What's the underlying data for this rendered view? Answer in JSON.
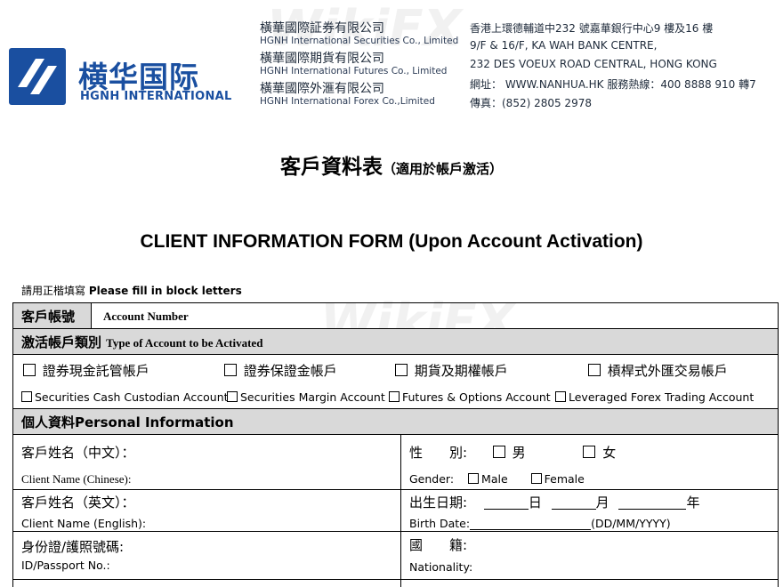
{
  "header": {
    "logo_cn": "横华国际",
    "logo_en": "HGNH INTERNATIONAL",
    "brand_color": "#1a4fa0",
    "companies": [
      {
        "cn": "橫華國際証券有限公司",
        "en": "HGNH International Securities Co., Limited"
      },
      {
        "cn": "橫華國際期貨有限公司",
        "en": "HGNH International Futures Co., Limited"
      },
      {
        "cn": "橫華國際外滙有限公司",
        "en": "HGNH International Forex Co.,Limited"
      }
    ],
    "address": [
      "香港上環德輔道中232 號嘉華銀行中心9 樓及16 樓",
      "9/F & 16/F, KA WAH BANK CENTRE,",
      "232 DES VOEUX ROAD CENTRAL, HONG KONG",
      "網址： WWW.NANHUA.HK 服務熱線：400 8888 910 轉7",
      "傳真：(852) 2805 2978"
    ]
  },
  "title": {
    "cn": "客戶資料表",
    "cn_note": "（適用於帳戶激活）",
    "en": "CLIENT INFORMATION FORM (Upon Account Activation)"
  },
  "note": {
    "cn": "請用正楷填寫",
    "en": "Please fill in block letters"
  },
  "form": {
    "account_number": {
      "cn": "客戶帳號",
      "en": "Account Number"
    },
    "account_type": {
      "cn": "激活帳戶類別",
      "en": "Type of Account to be Activated"
    },
    "account_options": [
      {
        "cn": "證券現金託管帳戶",
        "en": "Securities Cash Custodian Account"
      },
      {
        "cn": "證券保證金帳戶",
        "en": "Securities Margin Account"
      },
      {
        "cn": "期貨及期權帳戶",
        "en": "Futures & Options Account"
      },
      {
        "cn": "槓桿式外匯交易帳戶",
        "en": "Leveraged Forex Trading Account"
      }
    ],
    "personal_info": {
      "cn": "個人資料",
      "en": "Personal Information"
    },
    "name_cn": {
      "cn": "客戶姓名（中文）：",
      "en": "Client Name (Chinese):"
    },
    "gender": {
      "cn": "性　　別:",
      "male_cn": "男",
      "female_cn": "女",
      "en": "Gender:",
      "male_en": "Male",
      "female_en": "Female"
    },
    "name_en": {
      "cn": "客戶姓名（英文）：",
      "en": "Client Name (English):"
    },
    "birth": {
      "cn": "出生日期:",
      "day": "日",
      "month": "月",
      "year": "年",
      "en": "Birth Date:",
      "format": "(DD/MM/YYYY)"
    },
    "id": {
      "cn": "身份證/護照號碼:",
      "en": "ID/Passport No.:"
    },
    "nationality": {
      "cn": "國　　籍:",
      "en": "Nationality:"
    }
  },
  "watermark": "WikiFX",
  "colors": {
    "section_shade": "#d9d9d9"
  }
}
